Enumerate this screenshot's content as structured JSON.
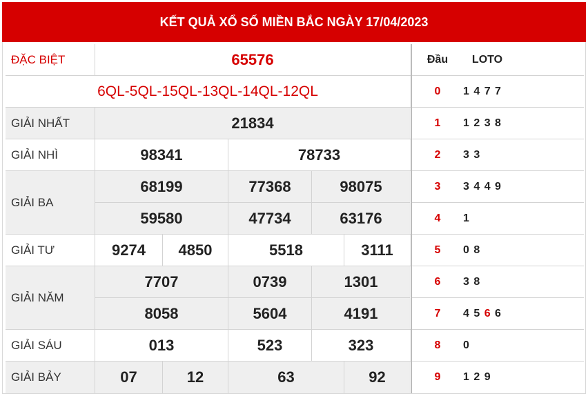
{
  "header": {
    "title": "KẾT QUẢ XỔ SỐ MIỀN BẮC NGÀY 17/04/2023"
  },
  "labels": {
    "db": "ĐẶC BIỆT",
    "g1": "GIẢI NHẤT",
    "g2": "GIẢI NHÌ",
    "g3": "GIẢI BA",
    "g4": "GIẢI TƯ",
    "g5": "GIẢI NĂM",
    "g6": "GIẢI SÁU",
    "g7": "GIẢI BẢY"
  },
  "prizes": {
    "db": "65576",
    "code": "6QL-5QL-15QL-13QL-14QL-12QL",
    "g1": "21834",
    "g2": [
      "98341",
      "78733"
    ],
    "g3": [
      "68199",
      "77368",
      "98075",
      "59580",
      "47734",
      "63176"
    ],
    "g4": [
      "9274",
      "4850",
      "5518",
      "3111"
    ],
    "g5": [
      "7707",
      "0739",
      "1301",
      "8058",
      "5604",
      "4191"
    ],
    "g6": [
      "013",
      "523",
      "323"
    ],
    "g7": [
      "07",
      "12",
      "63",
      "92"
    ]
  },
  "loto_header": {
    "dau": "Đầu",
    "loto": "LOTO"
  },
  "loto_rows": [
    {
      "dau": "0",
      "tails": "1 4 7 7"
    },
    {
      "dau": "1",
      "tails": "1 2 3 8"
    },
    {
      "dau": "2",
      "tails": "3 3"
    },
    {
      "dau": "3",
      "tails": "3 4 4 9"
    },
    {
      "dau": "4",
      "tails": "1"
    },
    {
      "dau": "5",
      "tails": "0 8"
    },
    {
      "dau": "6",
      "tails": "3 8"
    },
    {
      "dau": "7",
      "tails_pre": "4 5 ",
      "tails_hl": "6",
      "tails_post": " 6"
    },
    {
      "dau": "8",
      "tails": "0"
    },
    {
      "dau": "9",
      "tails": "1 2 9"
    }
  ],
  "colors": {
    "accent": "#d60000",
    "row_alt": "#efefef"
  }
}
